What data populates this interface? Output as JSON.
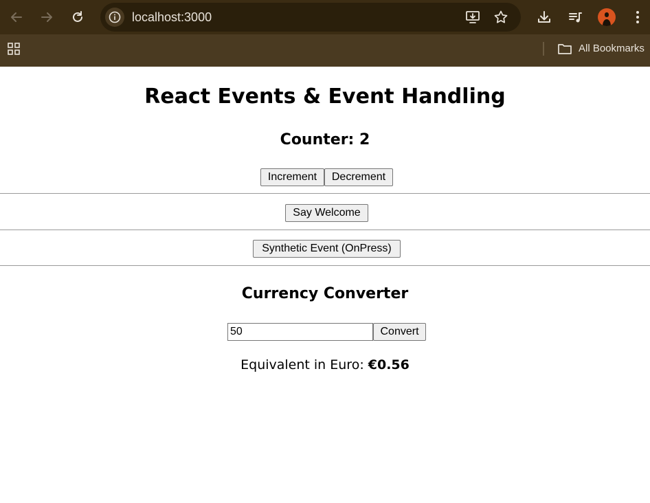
{
  "browser": {
    "url": "localhost:3000",
    "bookmarks_label": "All Bookmarks",
    "toolbar_color": "#3b2c13",
    "bookmarks_bar_color": "#4a3a21"
  },
  "icons": {
    "back": "back-arrow-icon",
    "forward": "forward-arrow-icon",
    "reload": "reload-icon",
    "site_info": "info-icon",
    "install": "install-app-icon",
    "bookmark": "star-icon",
    "downloads": "download-icon",
    "media": "media-control-icon",
    "menu": "kebab-menu-icon",
    "apps": "apps-grid-icon",
    "folder": "folder-icon"
  },
  "page": {
    "title": "React Events & Event Handling",
    "counter_label": "Counter: 2",
    "increment_label": "Increment",
    "decrement_label": "Decrement",
    "welcome_label": "Say Welcome",
    "synthetic_label": "Synthetic Event (OnPress)",
    "converter_title": "Currency Converter",
    "amount_value": "50",
    "convert_label": "Convert",
    "result_label": "Equivalent in Euro: ",
    "result_value": "€0.56"
  }
}
